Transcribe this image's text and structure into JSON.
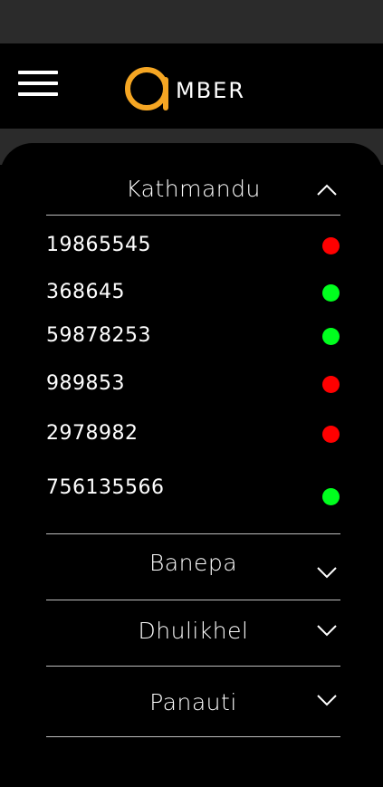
{
  "app": {
    "logo_letter": "a",
    "logo_text": "MBER",
    "brand_color": "#f5a623"
  },
  "colors": {
    "online": "#00ff1e",
    "offline": "#ff0000"
  },
  "icons": {
    "menu": "hamburger-menu-icon",
    "expanded": "chevron-up-icon",
    "collapsed": "chevron-down-icon"
  },
  "cities": [
    {
      "name": "Kathmandu",
      "expanded": true,
      "devices": [
        {
          "id": "19865545",
          "status": "offline"
        },
        {
          "id": "368645",
          "status": "online"
        },
        {
          "id": "59878253",
          "status": "online"
        },
        {
          "id": "989853",
          "status": "offline"
        },
        {
          "id": "2978982",
          "status": "offline"
        },
        {
          "id": "756135566",
          "status": "online"
        }
      ]
    },
    {
      "name": "Banepa",
      "expanded": false
    },
    {
      "name": "Dhulikhel",
      "expanded": false
    },
    {
      "name": "Panauti",
      "expanded": false
    }
  ]
}
